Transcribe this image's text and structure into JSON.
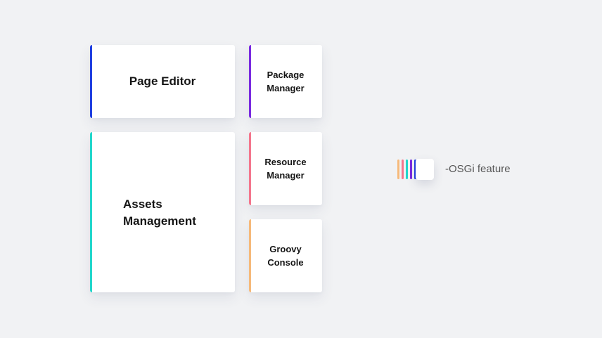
{
  "cards": {
    "page_editor": {
      "label": "Page Editor",
      "color": "#1f3fe0"
    },
    "package_manager": {
      "label": "Package\nManager",
      "color": "#7a2be0"
    },
    "assets_management": {
      "label": "Assets\nManagement",
      "color": "#22d6cb"
    },
    "resource_manager": {
      "label": "Resource\nManager",
      "color": "#f4768d"
    },
    "groovy_console": {
      "label": "Groovy\nConsole",
      "color": "#f6b97a"
    }
  },
  "legend": {
    "text": "-OSGi feature",
    "colors": [
      "#f6b97a",
      "#f4768d",
      "#22d6cb",
      "#7a2be0",
      "#1f3fe0"
    ]
  }
}
